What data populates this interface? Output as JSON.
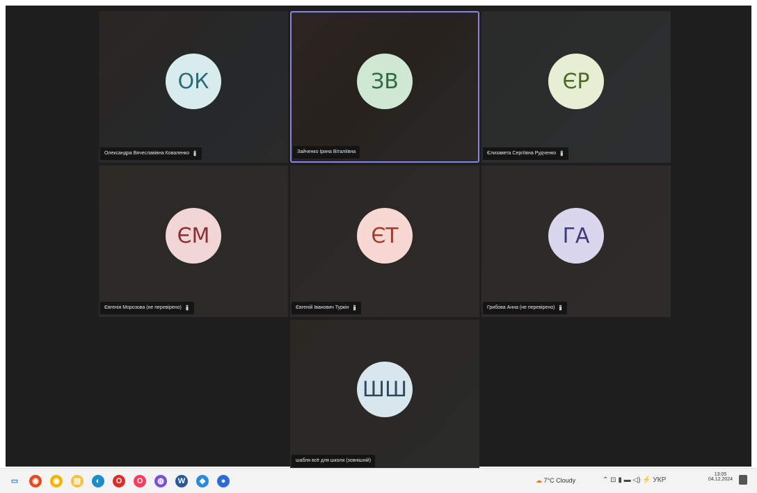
{
  "participants": [
    {
      "initials": "ОК",
      "name": "Олександра Вячеславівна Коваленко",
      "avatar_bg": "#d8ecee",
      "avatar_fg": "#2c6a78"
    },
    {
      "initials": "ЗВ",
      "name": "Зайченко Ірина Віталіївна",
      "avatar_bg": "#cfe8d3",
      "avatar_fg": "#2f6b3e"
    },
    {
      "initials": "ЄР",
      "name": "Єлизавета Сергіївна Рудченко",
      "avatar_bg": "#e6eed3",
      "avatar_fg": "#4d6a2b"
    },
    {
      "initials": "ЄМ",
      "name": "Євгенія Морозова (не перевірено)",
      "avatar_bg": "#f2d6d6",
      "avatar_fg": "#8a2f36"
    },
    {
      "initials": "ЄТ",
      "name": "Євгеній Іванович Туркін",
      "avatar_bg": "#f7d8d3",
      "avatar_fg": "#a03b2d"
    },
    {
      "initials": "ГА",
      "name": "Грибова Анна (не перевірено)",
      "avatar_bg": "#d9d6ee",
      "avatar_fg": "#3c3a7a"
    },
    {
      "initials": "ШШ",
      "name": "шабля всё для школи (зовнішній)",
      "avatar_bg": "#d8e6ee",
      "avatar_fg": "#2f4a5c"
    }
  ],
  "mic_glyph": "🎙",
  "taskbar": {
    "weather": "7°C Cloudy",
    "time": "13:05",
    "date": "04.12.2024",
    "tray_glyphs": "⌃ ⊡ ▮ ▬ ◁) ⚡ УКР",
    "apps": [
      {
        "name": "task-view-icon",
        "color": "#3a7bd5",
        "glyph": "▭"
      },
      {
        "name": "chrome-icon",
        "color": "#e64a19",
        "glyph": "◉"
      },
      {
        "name": "chrome-alt-icon",
        "color": "#f4b400",
        "glyph": "◉"
      },
      {
        "name": "file-explorer-icon",
        "color": "#f7c13a",
        "glyph": "▤"
      },
      {
        "name": "edge-icon",
        "color": "#1b8ec9",
        "glyph": "◐"
      },
      {
        "name": "opera-icon",
        "color": "#e02b2b",
        "glyph": "O"
      },
      {
        "name": "opera-gx-icon",
        "color": "#ff3b5c",
        "glyph": "O"
      },
      {
        "name": "viber-icon",
        "color": "#7b51d3",
        "glyph": "◍"
      },
      {
        "name": "word-icon",
        "color": "#2b5797",
        "glyph": "W"
      },
      {
        "name": "maps-icon",
        "color": "#2b8bd8",
        "glyph": "◆"
      },
      {
        "name": "zoom-icon",
        "color": "#2d6bd8",
        "glyph": "●"
      }
    ]
  }
}
